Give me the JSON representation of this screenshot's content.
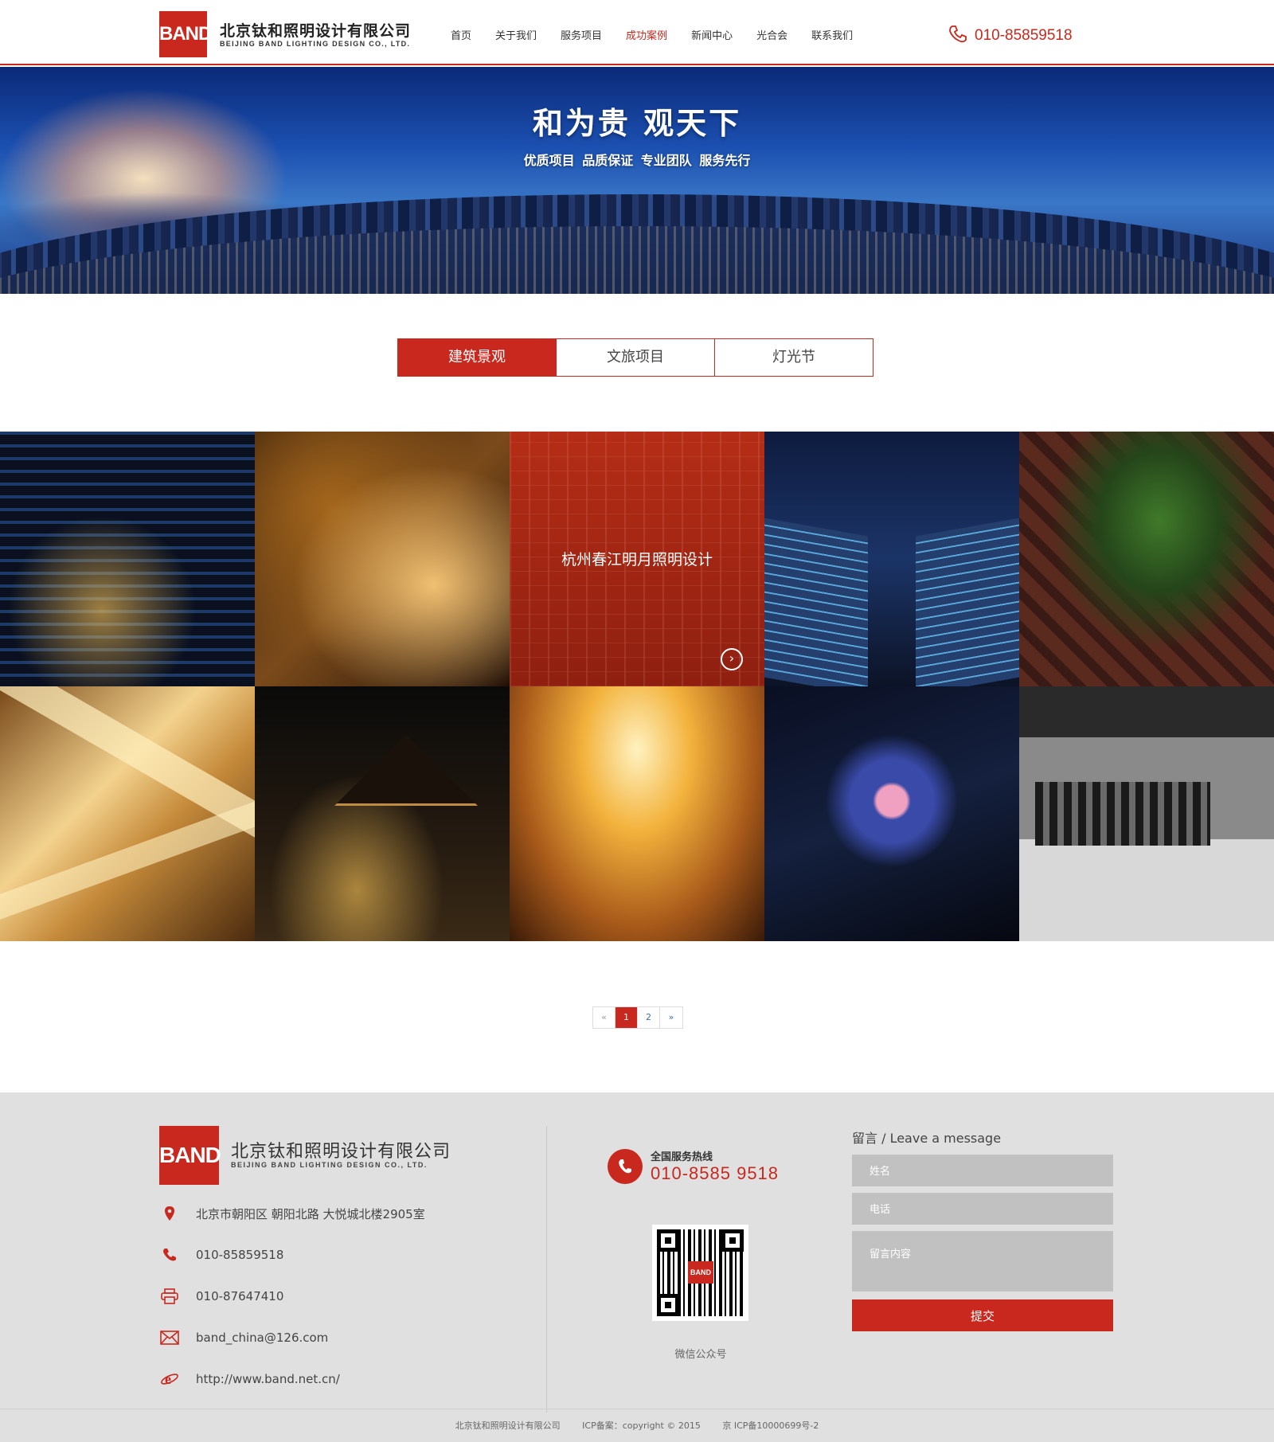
{
  "header": {
    "logo_mark": "BAND",
    "logo_cn": "北京钛和照明设计有限公司",
    "logo_en": "BEIJING BAND LIGHTING DESIGN CO., LTD.",
    "nav": [
      "首页",
      "关于我们",
      "服务项目",
      "成功案例",
      "新闻中心",
      "光合会",
      "联系我们"
    ],
    "active_nav": "成功案例",
    "phone": "010-85859518",
    "phone_icon": "phone-icon",
    "accent_color": "#c8281e"
  },
  "banner": {
    "title": "和为贵 观天下",
    "subtitle": "优质项目 品质保证 专业团队 服务先行"
  },
  "tabs": [
    {
      "label": "建筑景观",
      "active": true
    },
    {
      "label": "文旅项目",
      "active": false
    },
    {
      "label": "灯光节",
      "active": false
    }
  ],
  "gallery": {
    "hover_title": "杭州春江明月照明设计",
    "hover_icon": "arrow-right-circle-icon"
  },
  "pagination": {
    "prev": "«",
    "pages": [
      "1",
      "2"
    ],
    "current": "1",
    "next": "»"
  },
  "footer": {
    "logo_mark": "BAND",
    "company_cn": "北京钛和照明设计有限公司",
    "company_en": "BEIJING BAND LIGHTING DESIGN CO., LTD.",
    "address": "北京市朝阳区 朝阳北路 大悦城北楼2905室",
    "phone": "010-85859518",
    "fax": "010-87647410",
    "email": "band_china@126.com",
    "website": "http://www.band.net.cn/",
    "hotline_label": "全国服务热线",
    "hotline_number": "010-8585 9518",
    "qr_logo": "BAND",
    "qr_caption": "微信公众号",
    "message_title": "留言 / Leave a message",
    "name_placeholder": "姓名",
    "phone_placeholder": "电话",
    "content_placeholder": "留言内容",
    "submit_label": "提交",
    "copyright_company": "北京钛和照明设计有限公司",
    "copyright_text": "ICP备案：copyright © 2015",
    "icp": "京 ICP备10000699号-2"
  }
}
